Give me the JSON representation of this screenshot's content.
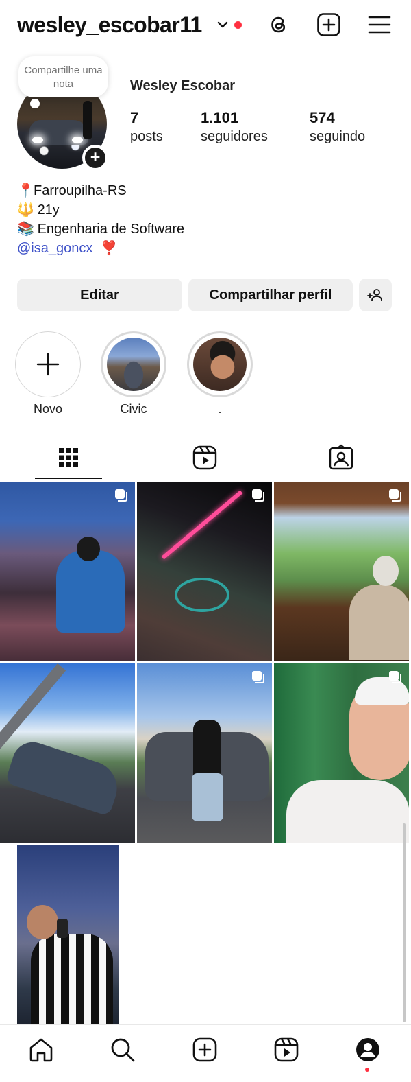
{
  "header": {
    "username": "wesley_escobar11",
    "icons": [
      "chevron-down-icon",
      "threads-icon",
      "create-post-icon",
      "menu-icon"
    ],
    "notification_color": "#ff3040"
  },
  "note": {
    "text": "Compartilhe uma nota"
  },
  "profile": {
    "full_name": "Wesley Escobar",
    "stats": [
      {
        "value": "7",
        "label": "posts"
      },
      {
        "value": "1.101",
        "label": "seguidores"
      },
      {
        "value": "574",
        "label": "seguindo"
      }
    ],
    "bio": {
      "location_emoji": "📍",
      "location": "Farroupilha-RS",
      "age_emoji": "🔱",
      "age": "21y",
      "study_emoji": "📚",
      "study": "Engenharia de Software",
      "mention": "@isa_goncx",
      "heart_emoji": "❣️"
    }
  },
  "actions": {
    "edit": "Editar",
    "share": "Compartilhar perfil",
    "discover_icon": "add-person-icon"
  },
  "highlights": [
    {
      "label": "Novo",
      "icon": "plus-icon"
    },
    {
      "label": "Civic"
    },
    {
      "label": "."
    }
  ],
  "tabs": [
    {
      "icon": "grid-icon",
      "active": true
    },
    {
      "icon": "reels-icon",
      "active": false
    },
    {
      "icon": "tagged-icon",
      "active": false
    }
  ],
  "posts": [
    {
      "multiple": true
    },
    {
      "multiple": true
    },
    {
      "multiple": true
    },
    {
      "multiple": false
    },
    {
      "multiple": true
    },
    {
      "multiple": true
    },
    {
      "multiple": false
    }
  ],
  "bottom_nav": [
    {
      "icon": "home-icon"
    },
    {
      "icon": "search-icon"
    },
    {
      "icon": "create-icon"
    },
    {
      "icon": "reels-icon"
    },
    {
      "icon": "profile-icon",
      "active": true
    }
  ]
}
